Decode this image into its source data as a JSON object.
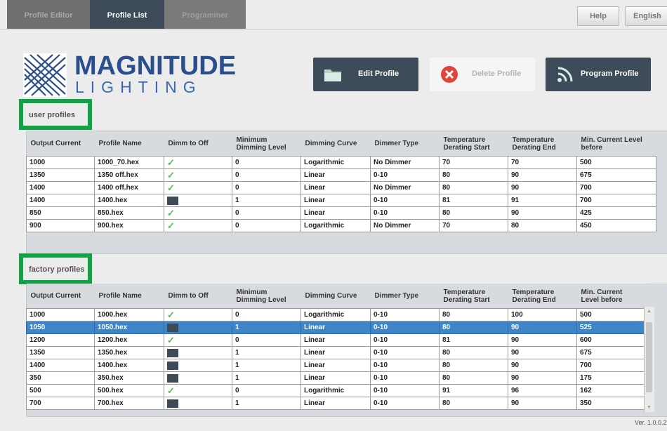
{
  "tabs": [
    "Profile Editor",
    "Profile List",
    "Programmer"
  ],
  "top_buttons": {
    "help": "Help",
    "language": "English"
  },
  "logo": {
    "line1": "MAGNITUDE",
    "line2": "LIGHTING"
  },
  "actions": {
    "edit": "Edit Profile",
    "delete": "Delete Profile",
    "program": "Program Profile"
  },
  "user_profiles": {
    "label": "user profiles",
    "columns": [
      "Output Current",
      "Profile Name",
      "Dimm to Off",
      "Minimum Dimming Level",
      "Dimming Curve",
      "Dimmer Type",
      "Temperature Derating Start",
      "Temperature Derating End",
      "Min. Current Level before"
    ],
    "rows": [
      [
        "1000",
        "1000_70.hex",
        "checked",
        "0",
        "Logarithmic",
        "No Dimmer",
        "70",
        "70",
        "500"
      ],
      [
        "1350",
        "1350 off.hex",
        "checked",
        "0",
        "Linear",
        "0-10",
        "80",
        "90",
        "675"
      ],
      [
        "1400",
        "1400 off.hex",
        "checked",
        "0",
        "Linear",
        "No Dimmer",
        "80",
        "90",
        "700"
      ],
      [
        "1400",
        "1400.hex",
        "unchecked",
        "1",
        "Linear",
        "0-10",
        "81",
        "91",
        "700"
      ],
      [
        "850",
        "850.hex",
        "checked",
        "0",
        "Linear",
        "0-10",
        "80",
        "90",
        "425"
      ],
      [
        "900",
        "900.hex",
        "checked",
        "0",
        "Logarithmic",
        "No Dimmer",
        "70",
        "80",
        "450"
      ]
    ]
  },
  "factory_profiles": {
    "label": "factory profiles",
    "columns": [
      "Output Current",
      "Profile Name",
      "Dimm to Off",
      "Minimum Dimming Level",
      "Dimming Curve",
      "Dimmer Type",
      "Temperature Derating Start",
      "Temperature Derating End",
      "Min. Current Level before"
    ],
    "selected_row": 1,
    "rows": [
      [
        "1000",
        "1000.hex",
        "checked",
        "0",
        "Logarithmic",
        "0-10",
        "80",
        "100",
        "500"
      ],
      [
        "1050",
        "1050.hex",
        "unchecked",
        "1",
        "Linear",
        "0-10",
        "80",
        "90",
        "525"
      ],
      [
        "1200",
        "1200.hex",
        "checked",
        "0",
        "Linear",
        "0-10",
        "81",
        "90",
        "600"
      ],
      [
        "1350",
        "1350.hex",
        "unchecked",
        "1",
        "Linear",
        "0-10",
        "80",
        "90",
        "675"
      ],
      [
        "1400",
        "1400.hex",
        "unchecked",
        "1",
        "Linear",
        "0-10",
        "80",
        "90",
        "700"
      ],
      [
        "350",
        "350.hex",
        "unchecked",
        "1",
        "Linear",
        "0-10",
        "80",
        "90",
        "175"
      ],
      [
        "500",
        "500.hex",
        "checked",
        "0",
        "Logarithmic",
        "0-10",
        "91",
        "96",
        "162"
      ],
      [
        "700",
        "700.hex",
        "unchecked",
        "1",
        "Linear",
        "0-10",
        "80",
        "90",
        "350"
      ]
    ]
  },
  "version": "Ver. 1.0.0.2",
  "colors": {
    "accent": "#3e4b58",
    "selection": "#3f86c9",
    "highlight_box": "#10a346",
    "check": "#5bb55f"
  }
}
